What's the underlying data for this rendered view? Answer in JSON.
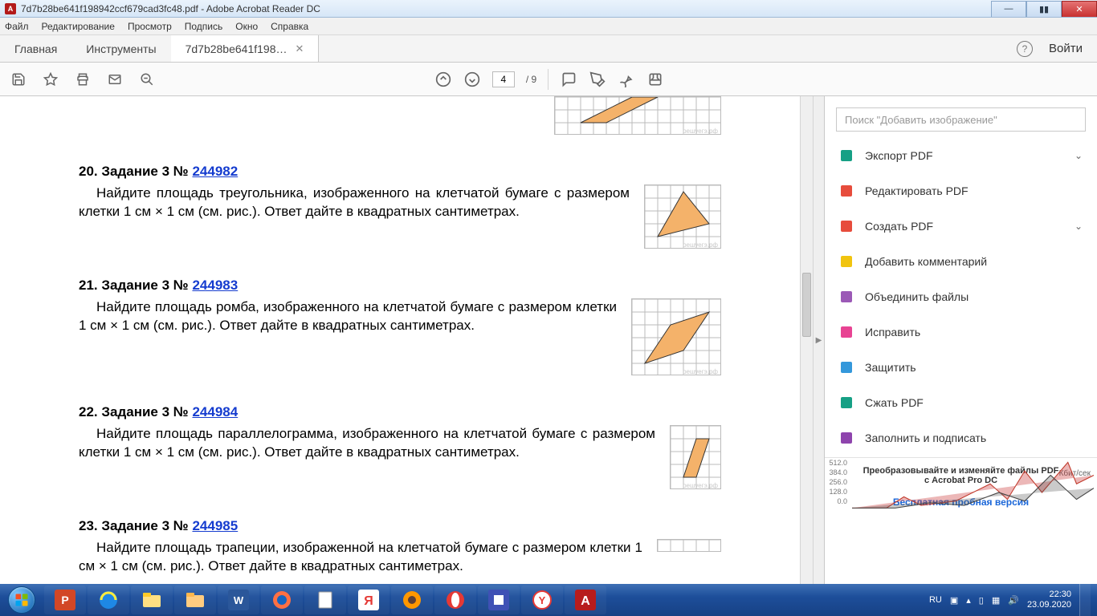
{
  "window": {
    "title": "7d7b28be641f198942ccf679cad3fc48.pdf - Adobe Acrobat Reader DC",
    "icon_letter": "A"
  },
  "menu": {
    "items": [
      "Файл",
      "Редактирование",
      "Просмотр",
      "Подпись",
      "Окно",
      "Справка"
    ]
  },
  "tabs": {
    "home": "Главная",
    "tools": "Инструменты",
    "doc": "7d7b28be641f198…",
    "login": "Войти"
  },
  "toolbar": {
    "page_current": "4",
    "page_total": "/ 9"
  },
  "rightpanel": {
    "search_placeholder": "Поиск \"Добавить изображение\"",
    "items": [
      {
        "label": "Экспорт PDF",
        "expand": true,
        "color": "#16a085"
      },
      {
        "label": "Редактировать PDF",
        "expand": false,
        "color": "#e74c3c"
      },
      {
        "label": "Создать PDF",
        "expand": true,
        "color": "#e74c3c"
      },
      {
        "label": "Добавить комментарий",
        "expand": false,
        "color": "#f1c40f"
      },
      {
        "label": "Объединить файлы",
        "expand": false,
        "color": "#9b59b6"
      },
      {
        "label": "Исправить",
        "expand": false,
        "color": "#e84393"
      },
      {
        "label": "Защитить",
        "expand": false,
        "color": "#3498db"
      },
      {
        "label": "Сжать PDF",
        "expand": false,
        "color": "#16a085"
      },
      {
        "label": "Заполнить и подписать",
        "expand": false,
        "color": "#8e44ad"
      }
    ],
    "promo_line1": "Преобразовывайте и изменяйте файлы PDF",
    "promo_line2": "с Acrobat Pro DC",
    "promo_unit": "Кбит/сек",
    "trial_link": "Бесплатная пробная версия",
    "yaxis": [
      "512.0",
      "384.0",
      "256.0",
      "128.0",
      "0.0"
    ]
  },
  "document": {
    "watermark": "решуегэ.рф",
    "tasks": [
      {
        "num": "20.",
        "prefix": "Задание 3 № ",
        "link": "244982",
        "text": "Найдите площадь треугольника, изображенного на клетчатой бумаге с размером клетки 1 см  ×  1 см (см. рис.). Ответ дайте в квадратных сантиметрах.",
        "shape": "triangle",
        "cols": 6,
        "rows": 5
      },
      {
        "num": "21.",
        "prefix": "Задание 3 № ",
        "link": "244983",
        "text": "Найдите площадь ромба, изображенного на клетчатой бумаге с размером клетки 1 см  ×  1 см (см. рис.). Ответ дайте в квадратных сантиметрах.",
        "shape": "rhombus",
        "cols": 7,
        "rows": 6
      },
      {
        "num": "22.",
        "prefix": "Задание 3 № ",
        "link": "244984",
        "text": "Найдите площадь параллелограмма, изображенного на клетчатой бумаге с размером клетки 1 см  ×  1 см (см. рис.). Ответ дайте в квадратных сантиметрах.",
        "shape": "parallelogram-tall",
        "cols": 4,
        "rows": 5
      },
      {
        "num": "23.",
        "prefix": "Задание 3 № ",
        "link": "244985",
        "text": "Найдите площадь трапеции, изображенной на клетчатой бумаге с размером клетки 1 см  ×  1 см (см. рис.). Ответ дайте в квадратных сантиметрах.",
        "shape": "none",
        "cols": 5,
        "rows": 1
      }
    ],
    "top_shape": {
      "shape": "parallelogram-top",
      "cols": 13,
      "rows": 3
    }
  },
  "tray": {
    "lang": "RU",
    "time": "22:30",
    "date": "23.09.2020"
  }
}
